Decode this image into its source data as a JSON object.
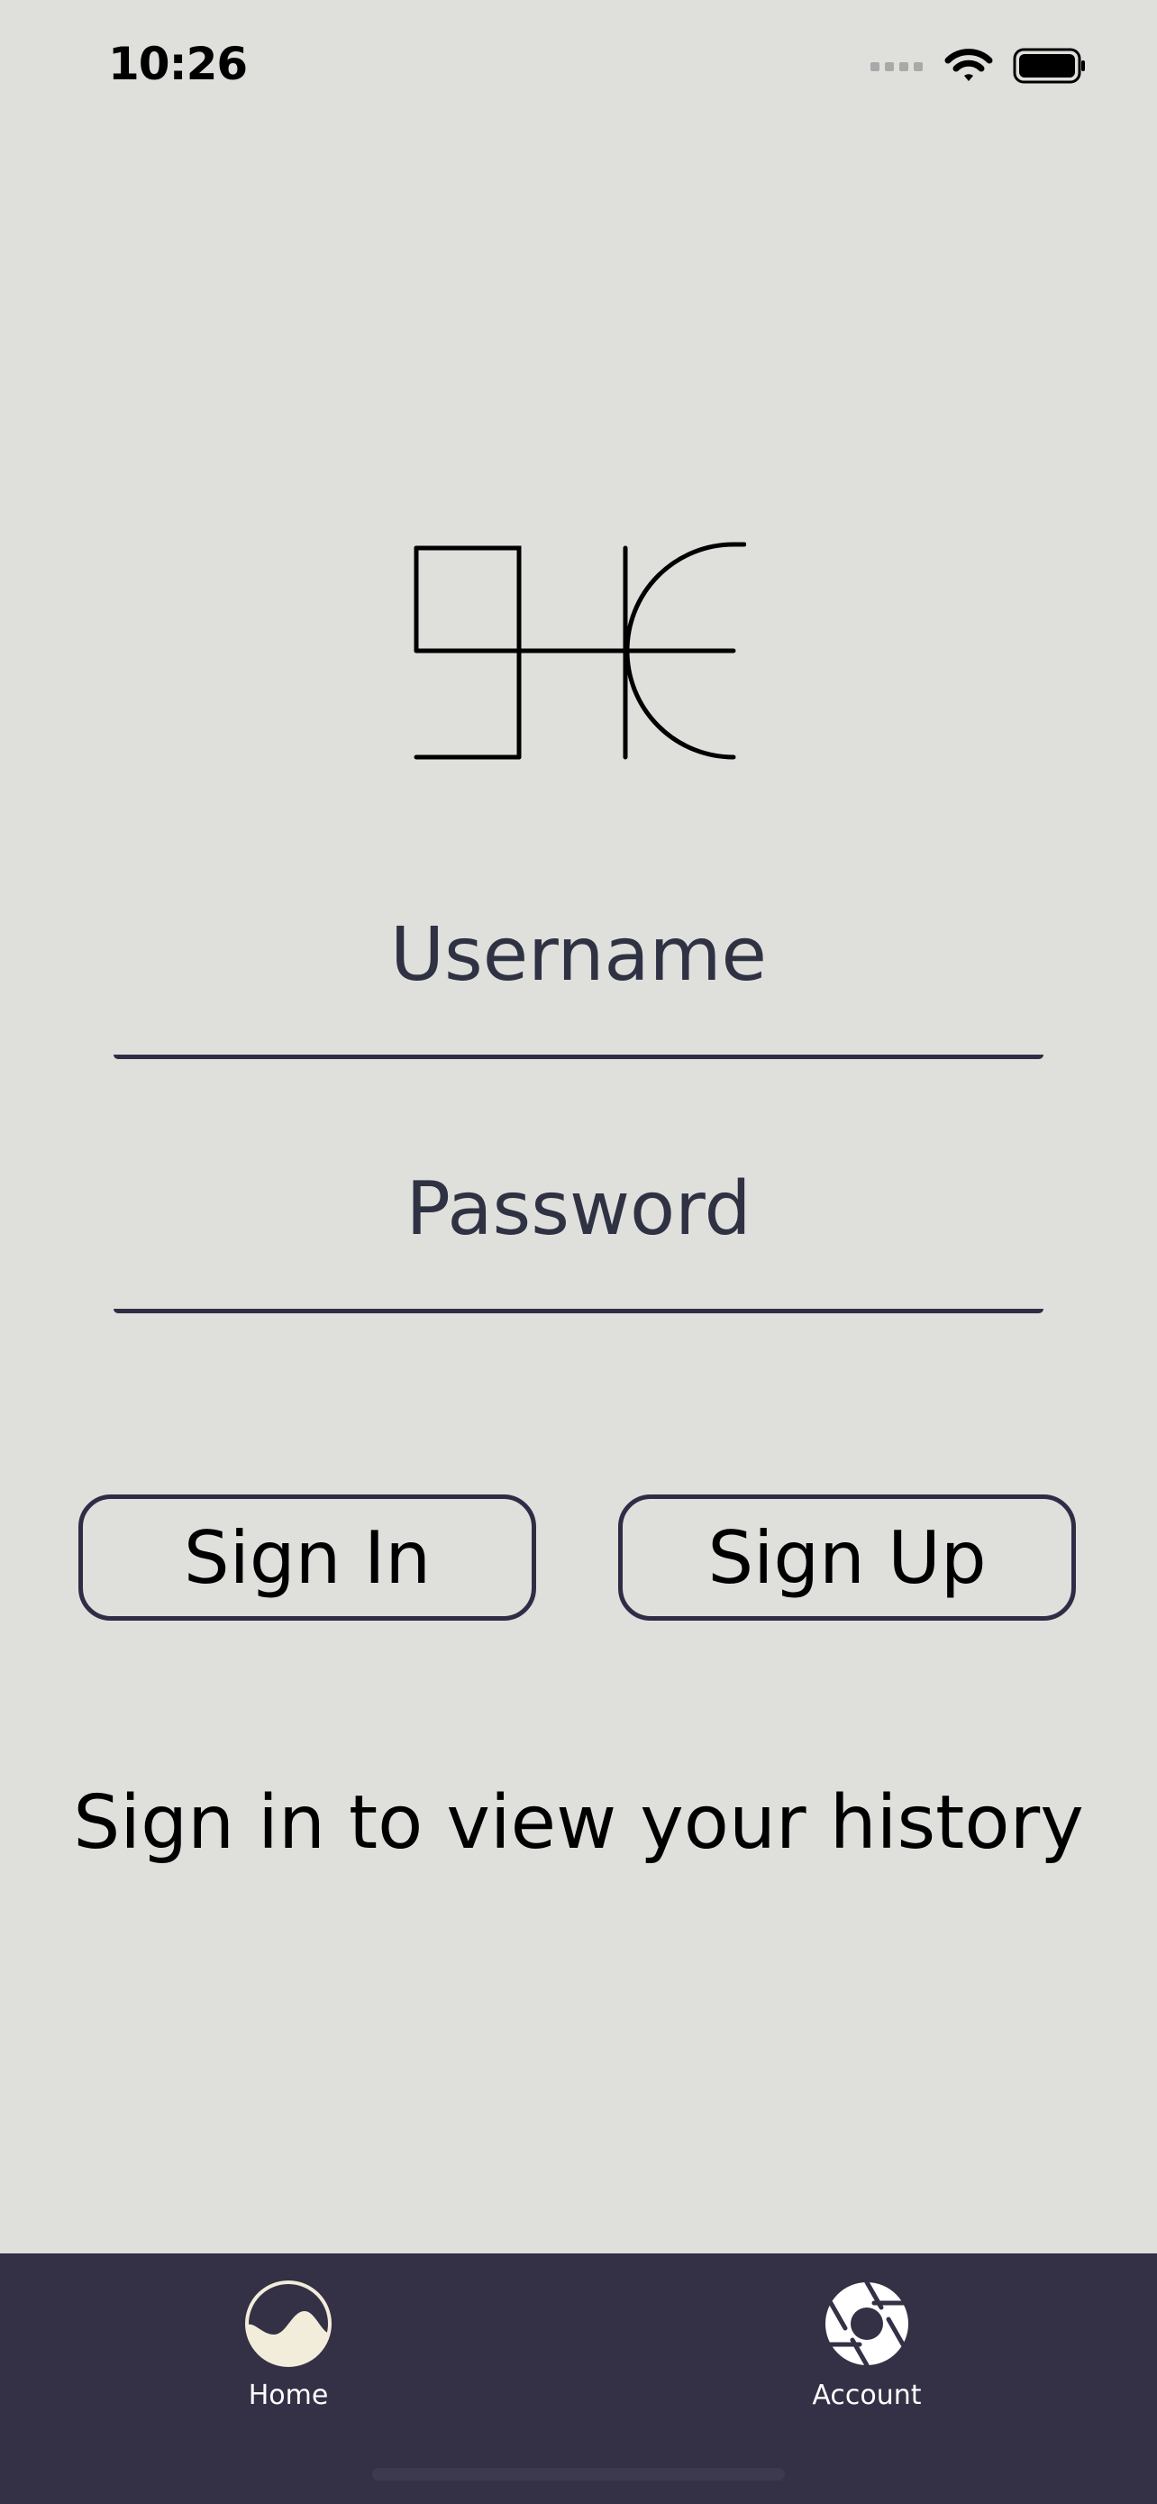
{
  "status_bar": {
    "time": "10:26",
    "icons": [
      "signal-icon",
      "wifi-icon",
      "battery-icon"
    ]
  },
  "logo": {
    "name": "app-logo"
  },
  "login_form": {
    "username_placeholder": "Username",
    "password_placeholder": "Password",
    "username_value": "",
    "password_value": ""
  },
  "buttons": {
    "sign_in": "Sign In",
    "sign_up": "Sign Up"
  },
  "message": "Sign in to view your history",
  "tab_bar": {
    "tabs": [
      {
        "label": "Home",
        "icon": "home-wave-icon"
      },
      {
        "label": "Account",
        "icon": "aperture-icon"
      }
    ]
  },
  "colors": {
    "background": "#dfdfdc",
    "tab_bar": "#343045",
    "accent": "#2f2d45",
    "home_icon_fill": "#f2ecda"
  }
}
